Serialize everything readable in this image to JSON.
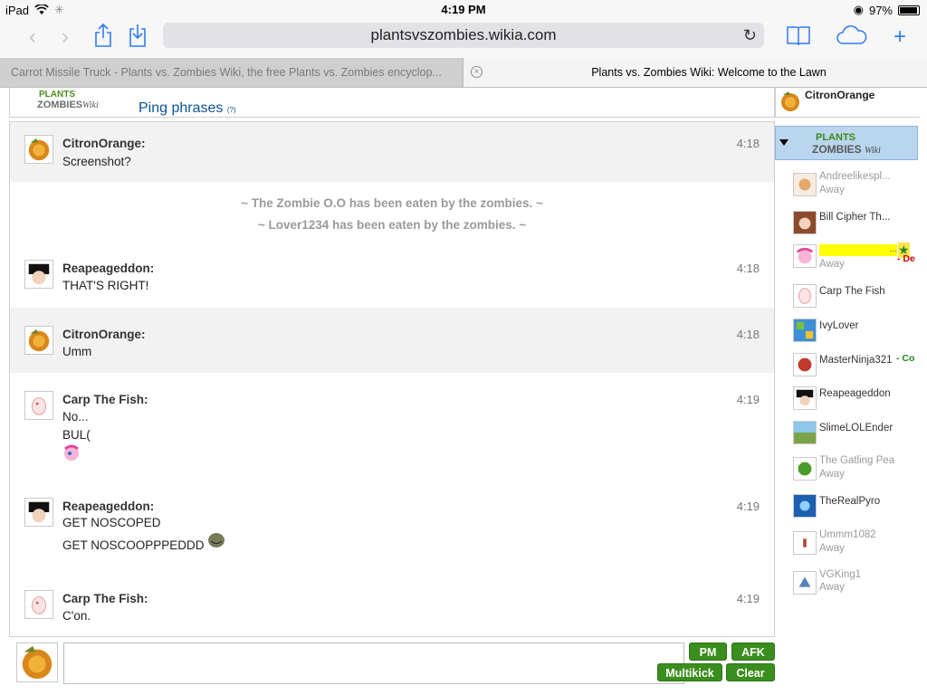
{
  "status_bar": {
    "device": "iPad",
    "time": "4:19 PM",
    "battery": "97%"
  },
  "browser": {
    "url": "plantsvszombies.wikia.com",
    "tabs": [
      {
        "title": "Carrot Missile Truck - Plants vs. Zombies Wiki, the free Plants vs. Zombies encyclop..."
      },
      {
        "title": "Plants vs. Zombies Wiki: Welcome to the Lawn"
      }
    ]
  },
  "header": {
    "ping_label": "Ping phrases",
    "ping_help": "(?)"
  },
  "self_user": {
    "name": "CitronOrange"
  },
  "messages": [
    {
      "user": "CitronOrange:",
      "lines": [
        "Screenshot?"
      ],
      "time": "4:18"
    },
    {
      "user": "Reapeageddon:",
      "lines": [
        "THAT'S RIGHT!"
      ],
      "time": "4:18"
    },
    {
      "user": "CitronOrange:",
      "lines": [
        "Umm"
      ],
      "time": "4:18"
    },
    {
      "user": "Carp The Fish:",
      "lines": [
        "No...",
        "BUL("
      ],
      "time": "4:19"
    },
    {
      "user": "Reapeageddon:",
      "lines": [
        "GET NOSCOPED",
        "GET NOSCOOPPPEDDD"
      ],
      "time": "4:19"
    },
    {
      "user": "Carp The Fish:",
      "lines": [
        "C'on."
      ],
      "time": "4:19"
    }
  ],
  "inline_alerts": [
    "~ The Zombie O.O has been eaten by the zombies. ~",
    "~ Lover1234 has been eaten by the zombies. ~"
  ],
  "buttons": {
    "pm": "PM",
    "afk": "AFK",
    "multikick": "Multikick",
    "clear": "Clear"
  },
  "users": [
    {
      "name": "Andreelikespl...",
      "status": "Away"
    },
    {
      "name": "Bill Cipher Th...",
      "status": ""
    },
    {
      "name": "...",
      "status": "Away",
      "tag": "- De"
    },
    {
      "name": "Carp The Fish",
      "status": ""
    },
    {
      "name": "IvyLover",
      "status": ""
    },
    {
      "name": "MasterNinja321",
      "status": "",
      "tag": "- Co"
    },
    {
      "name": "Reapeageddon",
      "status": ""
    },
    {
      "name": "SlimeLOLEnder",
      "status": ""
    },
    {
      "name": "The Gatling Pea",
      "status": "Away"
    },
    {
      "name": "TheRealPyro",
      "status": ""
    },
    {
      "name": "Ummm1082",
      "status": "Away"
    },
    {
      "name": "VGKing1",
      "status": "Away"
    }
  ],
  "colors": {
    "button_green": "#3a8e1d",
    "link_blue": "#0b5394",
    "accent_ios": "#2f7cf6"
  },
  "icons": [
    "wifi-icon",
    "share-icon",
    "download-icon",
    "bookmarks-icon",
    "icloud-icon",
    "new-tab-icon",
    "reload-icon",
    "close-tab-icon"
  ]
}
